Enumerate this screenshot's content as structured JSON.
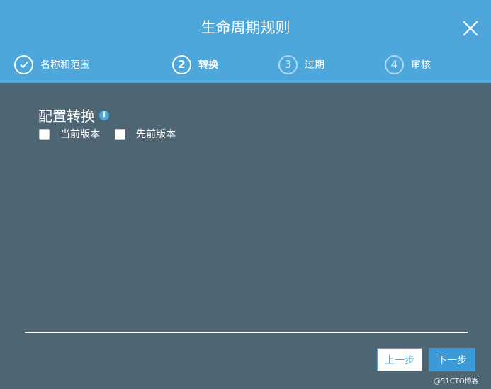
{
  "dialog": {
    "title": "生命周期规则",
    "close_icon": "close-icon"
  },
  "steps": [
    {
      "number": "",
      "label": "名称和范围",
      "state": "completed",
      "icon": "check-circle-icon"
    },
    {
      "number": "2",
      "label": "转换",
      "state": "active"
    },
    {
      "number": "3",
      "label": "过期",
      "state": "pending"
    },
    {
      "number": "4",
      "label": "审核",
      "state": "pending"
    }
  ],
  "section": {
    "title": "配置转换",
    "info_icon": "info-icon",
    "options": [
      {
        "label": "当前版本",
        "checked": false
      },
      {
        "label": "先前版本",
        "checked": false
      }
    ]
  },
  "footer": {
    "prev_label": "上一步",
    "next_label": "下一步"
  },
  "watermark": "@51CTO博客",
  "colors": {
    "header": "#4ea7db",
    "body": "#4e6573",
    "primary": "#3b9ad8"
  }
}
